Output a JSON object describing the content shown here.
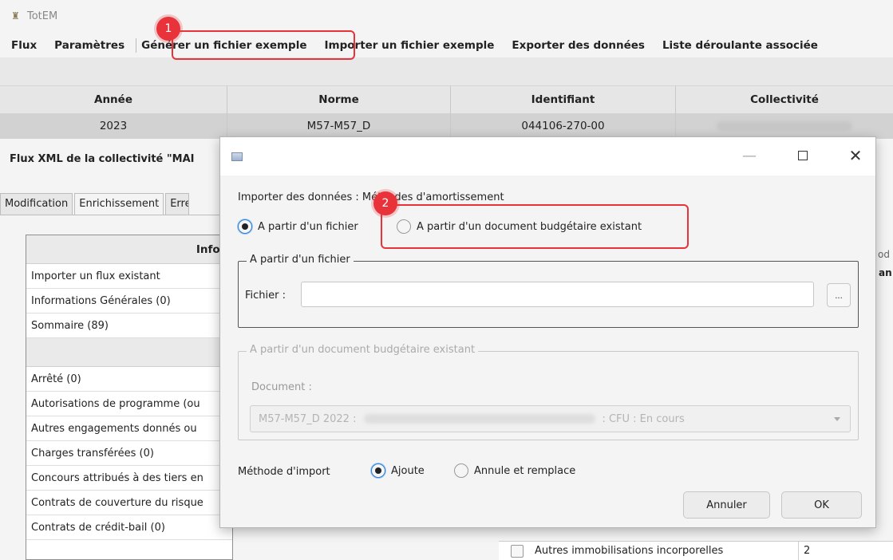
{
  "app": {
    "title": "TotEM"
  },
  "menu": [
    "Flux",
    "Paramètres",
    "Générer un fichier exemple",
    "Importer un fichier exemple",
    "Exporter des données",
    "Liste déroulante associée"
  ],
  "top_table": {
    "headers": [
      "Année",
      "Norme",
      "Identifiant",
      "Collectivité"
    ],
    "row": [
      "2023",
      "M57-M57_D",
      "044106-270-00",
      ""
    ]
  },
  "flux_title": "Flux XML de la collectivité \"MAI",
  "tabs": [
    "Modification",
    "Enrichissement",
    "Erre"
  ],
  "left_list": {
    "header": "Inforr",
    "items_top": [
      "Importer un flux existant",
      "Informations Générales (0)",
      "Sommaire (89)"
    ],
    "items": [
      "Arrêté (0)",
      "Autorisations de programme (ou",
      "Autres engagements donnés ou",
      "Charges transférées (0)",
      "Concours attribués à des tiers en",
      "Contrats de couverture du risque",
      "Contrats de crédit-bail (0)"
    ]
  },
  "background_right": {
    "row_label": "Autres immobilisations incorporelles",
    "row_value": "2",
    "edge_top": "od",
    "edge_header": "an"
  },
  "dialog": {
    "import_label": "Importer des données : Méthodes d'amortissement",
    "radio_file": "A partir d'un fichier",
    "radio_doc": "A partir d'un document budgétaire existant",
    "fieldset_file_legend": "A partir d'un fichier",
    "fichier_label": "Fichier :",
    "fichier_value": "",
    "browse_label": "...",
    "fieldset_doc_legend": "A partir d'un document budgétaire existant",
    "document_label": "Document :",
    "document_prefix": "M57-M57_D 2022 :",
    "document_suffix": ": CFU : En cours",
    "method_label": "Méthode d'import",
    "radio_ajoute": "Ajoute",
    "radio_annule": "Annule et remplace",
    "cancel": "Annuler",
    "ok": "OK",
    "selected_source": "A partir d'un fichier",
    "selected_method": "Ajoute"
  },
  "annotations": {
    "badge1": "1",
    "badge2": "2",
    "color": "#e8333a"
  }
}
